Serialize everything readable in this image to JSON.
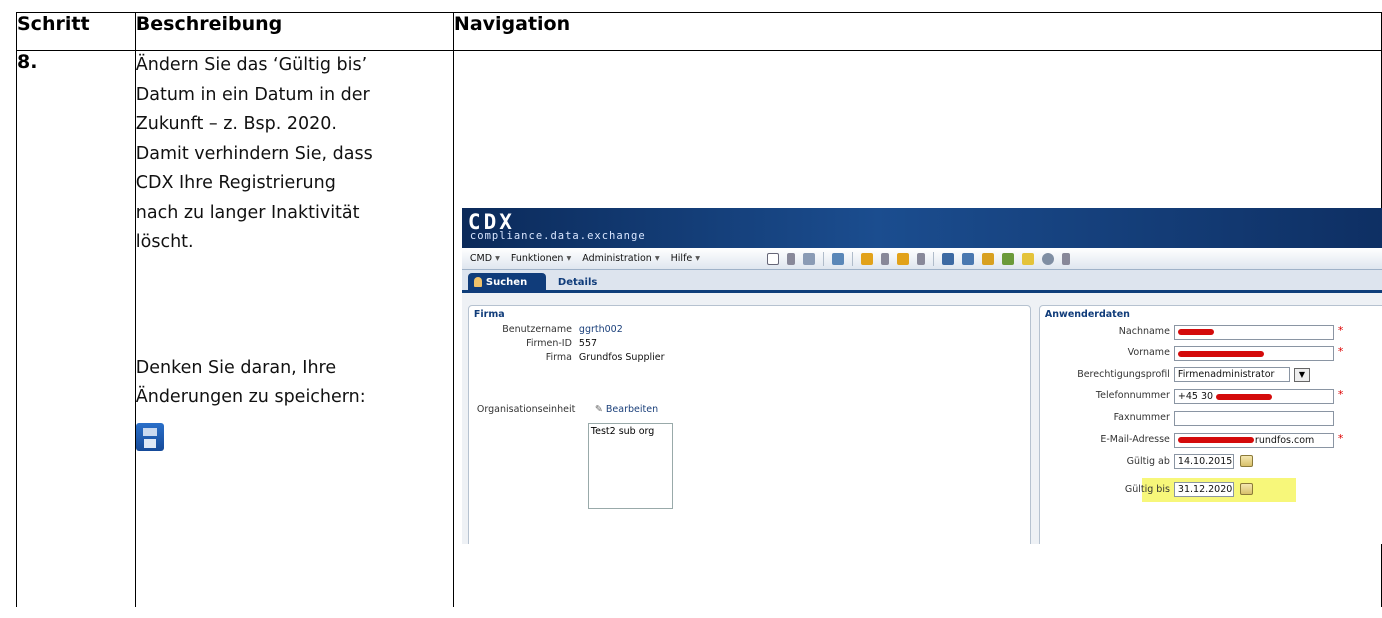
{
  "table": {
    "headers": [
      "Schritt",
      "Beschreibung",
      "Navigation"
    ],
    "step": "8.",
    "description_lines": [
      "Ändern Sie das ‘Gültig bis’",
      "Datum in ein Datum in der",
      "Zukunft – z. Bsp. 2020.",
      "Damit verhindern Sie, dass",
      "CDX Ihre Registrierung",
      "nach zu langer Inaktivität",
      "löscht."
    ],
    "reminder_lines": [
      "Denken Sie daran, Ihre",
      "Änderungen zu speichern:"
    ]
  },
  "app": {
    "logo": "CDX",
    "logo_sub": "compliance.data.exchange",
    "menus": [
      "CMD",
      "Funktionen",
      "Administration",
      "Hilfe"
    ],
    "tabs": {
      "search": "Suchen",
      "details": "Details"
    },
    "firma_panel": {
      "title": "Firma",
      "benutzername_label": "Benutzername",
      "benutzername": "ggrth002",
      "firmen_id_label": "Firmen-ID",
      "firmen_id": "557",
      "firma_label": "Firma",
      "firma": "Grundfos Supplier",
      "org_label": "Organisationseinheit",
      "edit_link": "Bearbeiten",
      "org_value": "Test2 sub org"
    },
    "user_panel": {
      "title": "Anwenderdaten",
      "nachname_label": "Nachname",
      "vorname_label": "Vorname",
      "profil_label": "Berechtigungsprofil",
      "profil_value": "Firmenadministrator",
      "telefon_label": "Telefonnummer",
      "telefon_prefix": "+45 30",
      "fax_label": "Faxnummer",
      "email_label": "E-Mail-Adresse",
      "email_visible": "rundfos.com",
      "gueltig_ab_label": "Gültig ab",
      "gueltig_ab": "14.10.2015",
      "gueltig_bis_label": "Gültig bis",
      "gueltig_bis": "31.12.2020"
    }
  },
  "colors": {
    "banner": "#0b2a5a",
    "highlight": "#f7f77a",
    "redaction": "#d40b0b",
    "tab_active": "#103c7a"
  }
}
